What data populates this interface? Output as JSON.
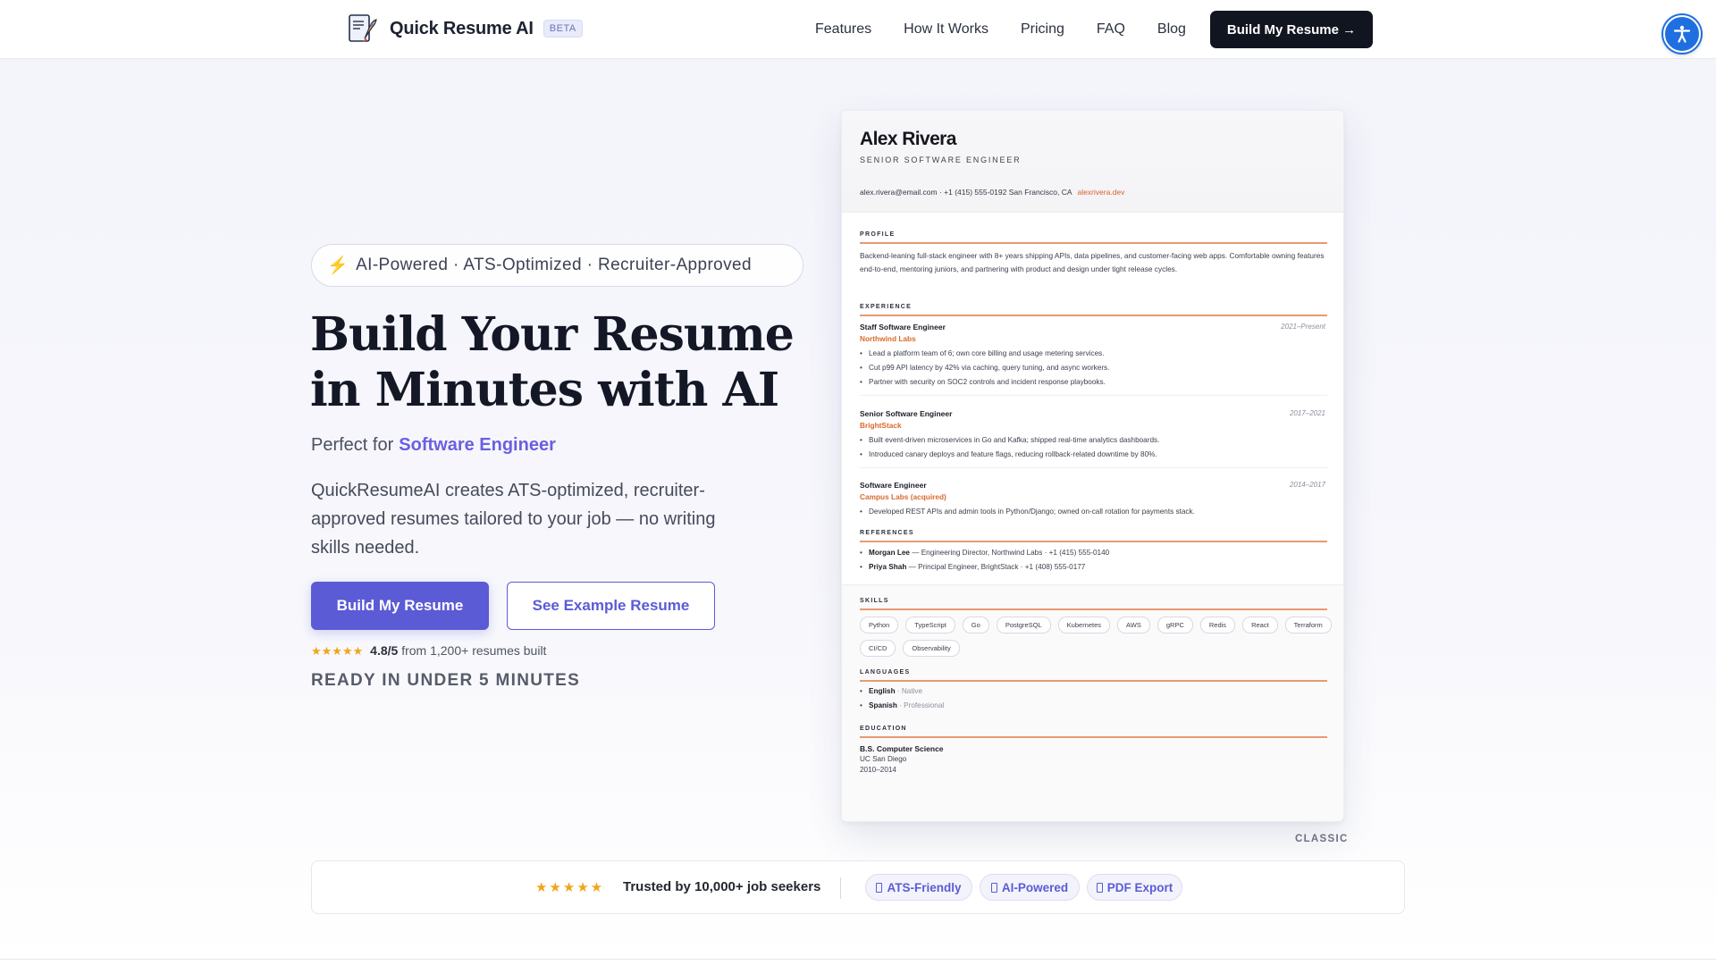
{
  "nav": {
    "brand": "Quick Resume AI",
    "beta": "BETA",
    "links": [
      "Features",
      "How It Works",
      "Pricing",
      "FAQ",
      "Blog"
    ],
    "cta": "Build My Resume →"
  },
  "hero": {
    "pill_icon": "⚡",
    "pill_text": "AI-Powered · ATS-Optimized · Recruiter-Approved",
    "headline_line1": "Build Your Resume",
    "headline_line2": "in Minutes with AI",
    "perfect_prefix": "Perfect for",
    "perfect_role": "Software Engineer",
    "description": "QuickResumeAI creates ATS-optimized, recruiter-approved resumes tailored to your job — no writing skills needed.",
    "primary_button": "Build My Resume",
    "secondary_button": "See Example Resume",
    "rating_stars": "★★★★★",
    "rating_score": "4.8/5",
    "rating_suffix": "from 1,200+ resumes built",
    "rating_value": 4.8,
    "ready_text": "READY IN UNDER 5 MINUTES"
  },
  "resume": {
    "name": "Alex Rivera",
    "title": "SENIOR SOFTWARE ENGINEER",
    "email": "alex.rivera@email.com",
    "phone": "+1 (415) 555-0192",
    "location": "San Francisco, CA",
    "website": "alexrivera.dev",
    "profile_label": "PROFILE",
    "profile_text": "Backend-leaning full-stack engineer with 8+ years shipping APIs, data pipelines, and customer-facing web apps. Comfortable owning features end-to-end, mentoring juniors, and partnering with product and design under tight release cycles.",
    "experience_label": "EXPERIENCE",
    "jobs": [
      {
        "title": "Staff Software Engineer",
        "company": "Northwind Labs",
        "dates": "2021–Present",
        "bullets": [
          "Lead a platform team of 6; own core billing and usage metering services.",
          "Cut p99 API latency by 42% via caching, query tuning, and async workers.",
          "Partner with security on SOC2 controls and incident response playbooks."
        ]
      },
      {
        "title": "Senior Software Engineer",
        "company": "BrightStack",
        "dates": "2017–2021",
        "bullets": [
          "Built event-driven microservices in Go and Kafka; shipped real-time analytics dashboards.",
          "Introduced canary deploys and feature flags, reducing rollback-related downtime by 80%."
        ]
      },
      {
        "title": "Software Engineer",
        "company": "Campus Labs (acquired)",
        "dates": "2014–2017",
        "bullets": [
          "Developed REST APIs and admin tools in Python/Django; owned on-call rotation for payments stack."
        ]
      }
    ],
    "references_label": "REFERENCES",
    "references": [
      {
        "name": "Morgan Lee",
        "detail": "— Engineering Director, Northwind Labs · +1 (415) 555-0140"
      },
      {
        "name": "Priya Shah",
        "detail": "— Principal Engineer, BrightStack · +1 (408) 555-0177"
      }
    ],
    "skills_label": "SKILLS",
    "skills": [
      "Python",
      "TypeScript",
      "Go",
      "PostgreSQL",
      "Kubernetes",
      "AWS",
      "gRPC",
      "Redis",
      "React",
      "Terraform",
      "CI/CD",
      "Observability"
    ],
    "languages_label": "LANGUAGES",
    "languages": [
      {
        "name": "English",
        "level": "· Native"
      },
      {
        "name": "Spanish",
        "level": "· Professional"
      }
    ],
    "education_label": "EDUCATION",
    "education_degree": "B.S. Computer Science",
    "education_school": "UC San Diego",
    "education_years": "2010–2014",
    "template_label": "CLASSIC"
  },
  "trust": {
    "stars": "★★★★★",
    "text": "Trusted by 10,000+ job seekers",
    "badges": [
      "ATS-Friendly",
      "AI-Powered",
      "PDF Export"
    ]
  },
  "colors": {
    "accent": "#5b5bd6",
    "nav_cta": "#11151f",
    "resume_accent": "#d96a2e",
    "star": "#f0a51a",
    "a11y_button": "#1f6fe0"
  },
  "icons": {
    "logo": "rocket-document-icon",
    "accessibility": "accessibility-person-icon",
    "pill": "lightning-bolt-icon",
    "badge": "document-icon"
  }
}
